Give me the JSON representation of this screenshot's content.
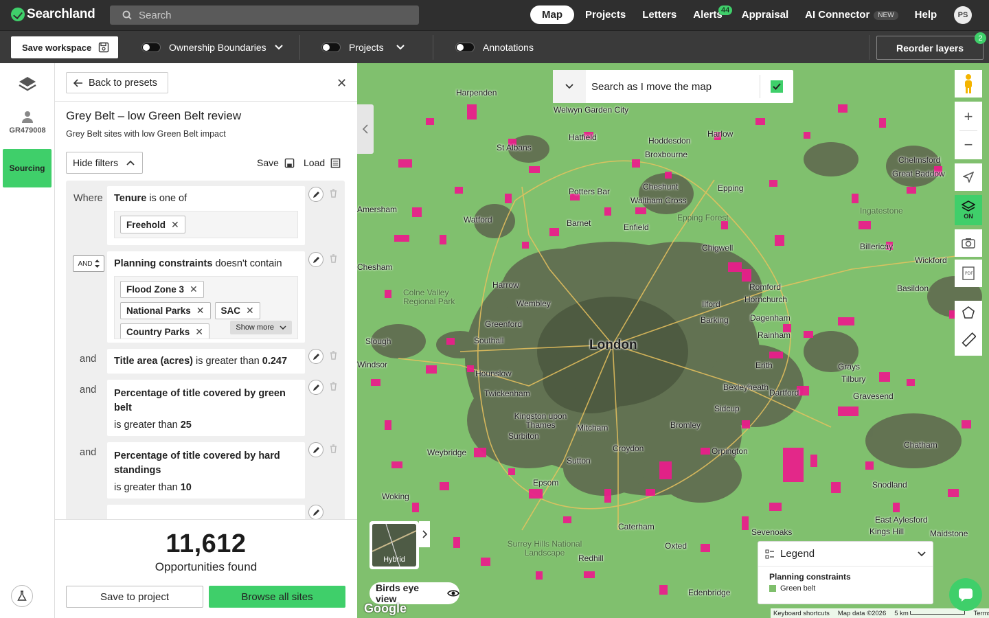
{
  "app": {
    "name": "Searchland"
  },
  "search": {
    "placeholder": "Search"
  },
  "nav": {
    "items": [
      "Map",
      "Projects",
      "Letters",
      "Alerts",
      "Appraisal",
      "AI Connector",
      "Help"
    ],
    "alerts_count": "44",
    "new_badge": "NEW",
    "user_initials": "PS"
  },
  "toolbar": {
    "save_workspace": "Save workspace",
    "ownership": "Ownership Boundaries",
    "projects": "Projects",
    "annotations": "Annotations",
    "reorder": "Reorder layers",
    "reorder_count": "2"
  },
  "rail": {
    "user_id": "GR479008",
    "sourcing": "Sourcing"
  },
  "panel": {
    "back": "Back to presets",
    "title": "Grey Belt – low Green Belt review",
    "subtitle": "Grey Belt sites with low Green Belt impact",
    "hide_filters": "Hide filters",
    "save": "Save",
    "load": "Load"
  },
  "filters": [
    {
      "conj": "Where",
      "field": "Tenure",
      "op": "is one of",
      "chips": [
        "Freehold"
      ]
    },
    {
      "conj": "AND",
      "field": "Planning constraints",
      "op": "doesn't contain",
      "chips": [
        "Flood Zone 3",
        "National Parks",
        "SAC",
        "Country Parks"
      ],
      "show_more": "Show more"
    },
    {
      "conj": "and",
      "field": "Title area (acres)",
      "op": "is greater than",
      "value": "0.247"
    },
    {
      "conj": "and",
      "field": "Percentage of title covered by green belt",
      "op": "is greater than",
      "value": "25"
    },
    {
      "conj": "and",
      "field": "Percentage of title covered by hard standings",
      "op": "is greater than",
      "value": "10"
    }
  ],
  "results": {
    "count": "11,612",
    "label": "Opportunities found",
    "save_to_project": "Save to project",
    "browse": "Browse all sites"
  },
  "map": {
    "search_as_move": "Search as I move the map",
    "layers_on": "ON",
    "hybrid": "Hybrid",
    "birds_eye": "Birds eye view",
    "google": "Google",
    "legend": {
      "title": "Legend",
      "section": "Planning constraints",
      "item": "Green belt"
    },
    "attribution": [
      "Keyboard shortcuts",
      "Map data ©2026",
      "5 km",
      "Terms"
    ],
    "places": [
      "Harpenden",
      "Welwyn Garden City",
      "Hatfield",
      "Harlow",
      "Hoddesdon",
      "Broxbourne",
      "St Albans",
      "Chelmsford",
      "Great Baddow",
      "Cheshunt",
      "Waltham Cross",
      "Potters Bar",
      "Epping",
      "Ingatestone",
      "Watford",
      "Barnet",
      "Enfield",
      "Epping Forest",
      "Chigwell",
      "Billericay",
      "Wickford",
      "Harrow",
      "Colne Valley Regional Park",
      "Romford",
      "Hornchurch",
      "Basildon",
      "Wembley",
      "Ilford",
      "Barking",
      "Dagenham",
      "Greenford",
      "Slough",
      "Southall",
      "London",
      "Rainham",
      "Windsor",
      "Hounslow",
      "Erith",
      "Grays",
      "Tilbury",
      "Twickenham",
      "Bexleyheath",
      "Dartford",
      "Gravesend",
      "Kingston upon Thames",
      "Surbiton",
      "Mitcham",
      "Bromley",
      "Sidcup",
      "Weybridge",
      "Croydon",
      "Orpington",
      "Chatham",
      "Sutton",
      "Woking",
      "Epsom",
      "Snodland",
      "East Aylesford",
      "Maidstone",
      "Kings Hill",
      "Caterham",
      "Redhill",
      "Oxted",
      "Sevenoaks",
      "Surrey Hills National Landscape",
      "Edenbridge",
      "Chesham",
      "Amersham",
      "Rainham"
    ]
  }
}
